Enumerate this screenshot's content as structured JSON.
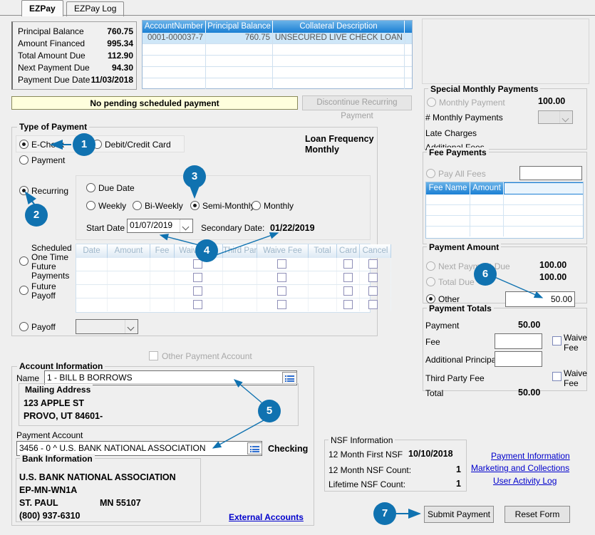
{
  "tabs": [
    {
      "label": "EZPay",
      "active": true
    },
    {
      "label": "EZPay Log",
      "active": false
    }
  ],
  "summary": {
    "rows": [
      {
        "label": "Principal Balance",
        "value": "760.75"
      },
      {
        "label": "Amount Financed",
        "value": "995.34"
      },
      {
        "label": "Total Amount Due",
        "value": "112.90"
      },
      {
        "label": "Next Payment Due",
        "value": "94.30"
      },
      {
        "label": "Payment Due Date",
        "value": "11/03/2018"
      }
    ]
  },
  "account_grid": {
    "columns": [
      "AccountNumber",
      "Principal Balance",
      "Collateral Description"
    ],
    "rows": [
      {
        "account_number": "0001-000037-7",
        "principal_balance": "760.75",
        "collateral_description": "UNSECURED LIVE CHECK LOAN"
      }
    ],
    "empty_row_count": 4
  },
  "pending": {
    "message": "No pending scheduled payment",
    "discontinue_label": "Discontinue Recurring Payment"
  },
  "type_of_payment": {
    "title": "Type of Payment",
    "echeck": "E-Check",
    "debit_credit": "Debit/Credit Card",
    "payment": "Payment",
    "recurring": "Recurring",
    "scheduled_one_time": [
      "Scheduled",
      "One Time",
      "Future",
      "Payments"
    ],
    "future_payoff": [
      "Future",
      "Payoff"
    ],
    "payoff": "Payoff",
    "loan_frequency_label": "Loan Frequency",
    "loan_frequency_value": "Monthly",
    "recurrence": {
      "due_date": "Due Date",
      "weekly": "Weekly",
      "bi_weekly": "Bi-Weekly",
      "semi_monthly": "Semi-Monthly",
      "monthly": "Monthly",
      "start_date_label": "Start Date",
      "start_date_value": "01/07/2019",
      "secondary_date_label": "Secondary Date:",
      "secondary_date_value": "01/22/2019"
    },
    "payoff_combo_value": ""
  },
  "sched_grid": {
    "columns": [
      "Date",
      "Amount",
      "Fee",
      "Waive Fee",
      "Third Party",
      "Waive Fee",
      "Total",
      "Card",
      "Cancel"
    ],
    "empty_row_count": 4
  },
  "other_payment_account": "Other Payment Account",
  "account_information": {
    "title": "Account Information",
    "name_label": "Name",
    "name_value": "1 - BILL B BORROWS",
    "mailing_address_title": "Mailing Address",
    "mailing_address_lines": [
      "123 APPLE ST",
      "PROVO, UT  84601-"
    ],
    "payment_account_label": "Payment Account",
    "payment_account_value": "3456 - 0 ^ U.S. BANK NATIONAL ASSOCIATION",
    "payment_account_type": "Checking",
    "bank_information_title": "Bank Information",
    "bank_lines": [
      "U.S. BANK NATIONAL ASSOCIATION",
      "EP-MN-WN1A"
    ],
    "bank_city": "ST. PAUL",
    "bank_state_zip": "MN 55107",
    "bank_phone": "(800) 937-6310",
    "external_accounts_link": "External Accounts"
  },
  "special_monthly_payments": {
    "title": "Special Monthly Payments",
    "monthly_payment_label": "Monthly Payment",
    "monthly_payment_value": "100.00",
    "num_monthly_payments_label": "# Monthly Payments",
    "num_monthly_payments_value": "",
    "late_charges_label": "Late Charges",
    "additional_fees_label": "Additional Fees"
  },
  "fee_payments": {
    "title": "Fee Payments",
    "pay_all_fees_label": "Pay All Fees",
    "pay_all_fees_value": "",
    "columns": [
      "Fee Name",
      "Amount"
    ],
    "empty_row_count": 4
  },
  "payment_amount": {
    "title": "Payment Amount",
    "next_payment_due_label": "Next Payment Due",
    "next_payment_due_value": "100.00",
    "total_due_label": "Total Due",
    "total_due_value": "100.00",
    "other_label": "Other",
    "other_value": "50.00"
  },
  "payment_totals": {
    "title": "Payment Totals",
    "payment_label": "Payment",
    "payment_value": "50.00",
    "fee_label": "Fee",
    "fee_value": "",
    "additional_principal_label": "Additional Principal",
    "additional_principal_value": "",
    "third_party_fee_label": "Third Party Fee",
    "total_label": "Total",
    "total_value": "50.00",
    "waive_fee_label_1": "Waive",
    "waive_fee_label_1b": "Fee",
    "waive_fee_label_2": "Waive",
    "waive_fee_label_2b": "Fee"
  },
  "nsf": {
    "title": "NSF Information",
    "first_nsf_label": "12 Month First NSF",
    "first_nsf_value": "10/10/2018",
    "twelve_month_count_label": "12 Month NSF Count:",
    "twelve_month_count_value": "1",
    "lifetime_count_label": "Lifetime NSF Count:",
    "lifetime_count_value": "1"
  },
  "links": {
    "payment_information": "Payment Information",
    "marketing_and_collections": "Marketing and Collections",
    "user_activity_log": "User Activity Log"
  },
  "buttons": {
    "submit_payment": "Submit Payment",
    "reset_form": "Reset Form"
  },
  "annotations": {
    "badge_color": "#1072b0",
    "items": [
      {
        "num": "1",
        "target": "echeck-radio"
      },
      {
        "num": "2",
        "target": "recurring-radio"
      },
      {
        "num": "3",
        "target": "semi-monthly-radio"
      },
      {
        "num": "4",
        "target": "start-date-and-secondary-date"
      },
      {
        "num": "5",
        "target": "name-and-payment-account"
      },
      {
        "num": "6",
        "target": "other-amount-input"
      },
      {
        "num": "7",
        "target": "submit-payment-button"
      }
    ]
  }
}
